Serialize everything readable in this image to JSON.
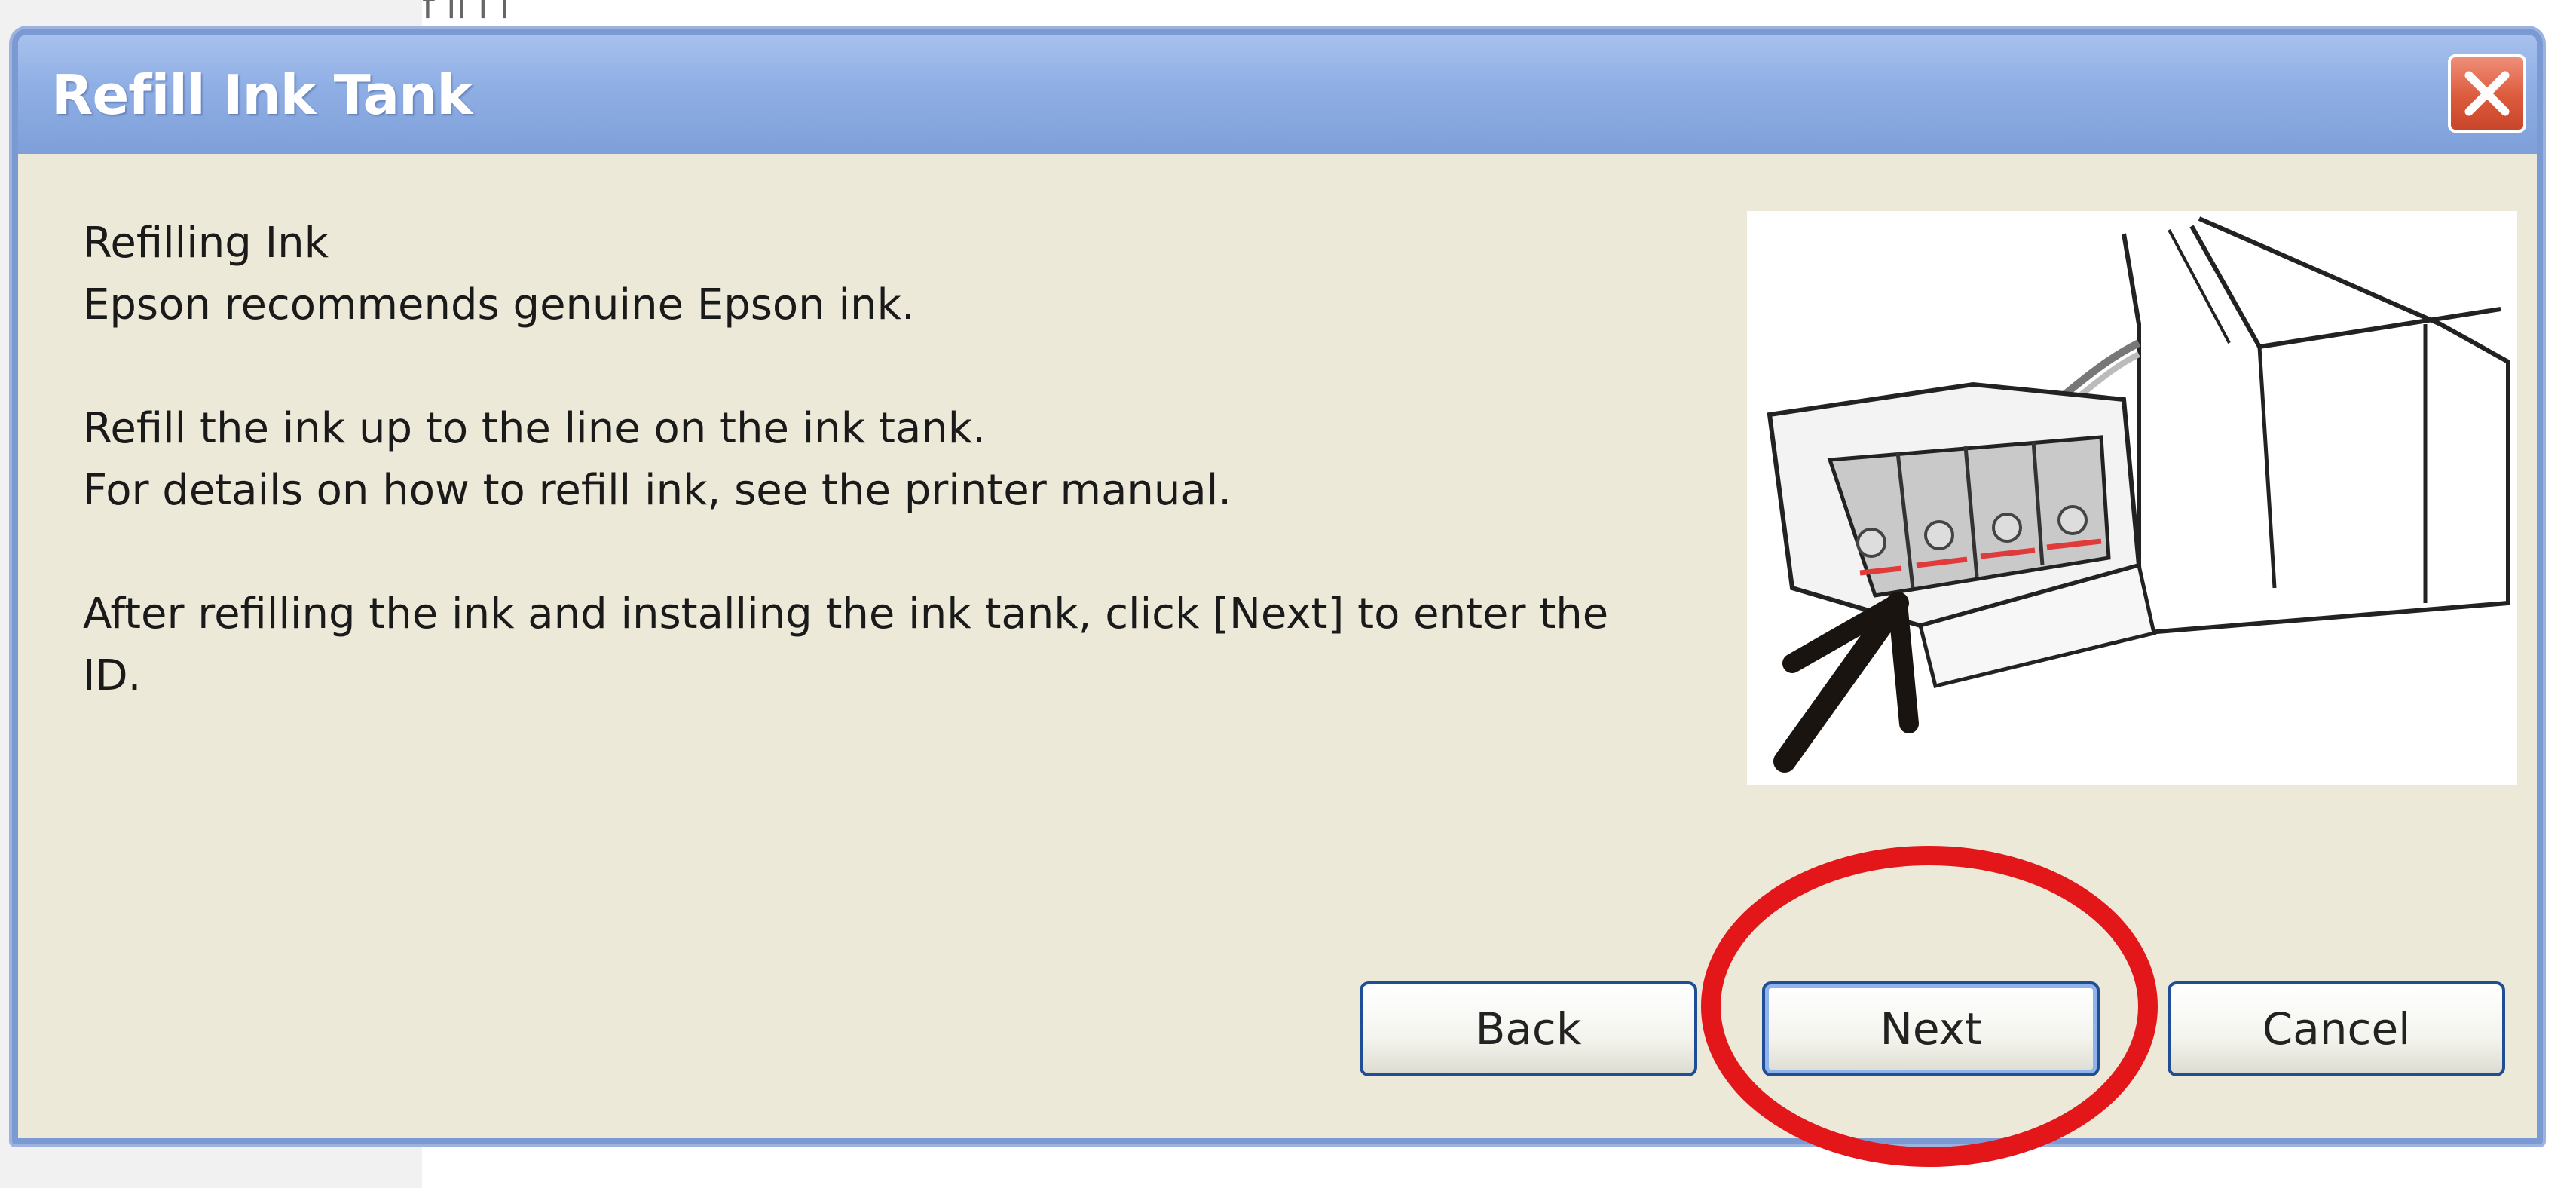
{
  "background": {
    "top_text": "f                          ll   l l"
  },
  "window": {
    "title": "Refill Ink Tank",
    "close_label": "×"
  },
  "content": {
    "lines": [
      "Refilling Ink",
      "Epson recommends genuine Epson ink.",
      "Refill the ink up to the line on the ink tank.",
      "For details on how to refill ink, see the printer manual.",
      "After refilling the ink and installing the ink tank, click [Next] to enter the ID."
    ]
  },
  "illustration": {
    "description_icon": "ink-tank-refill-illustration",
    "line_color": "#e03a3a"
  },
  "buttons": {
    "back": "Back",
    "next": "Next",
    "cancel": "Cancel"
  },
  "annotation": {
    "color": "#e3161a"
  }
}
